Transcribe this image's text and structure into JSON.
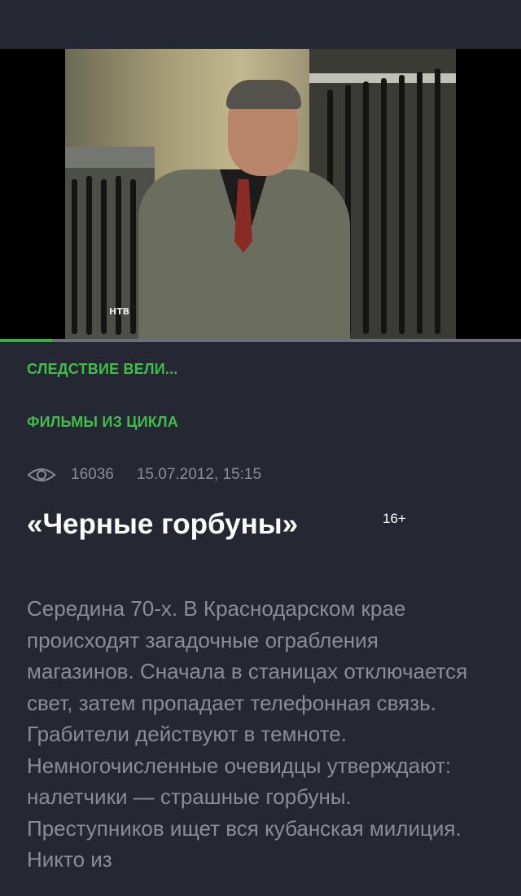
{
  "video": {
    "channel_logo": "НТВ",
    "progress": 0.1
  },
  "show": {
    "name": "СЛЕДСТВИЕ ВЕЛИ...",
    "category": "ФИЛЬМЫ ИЗ ЦИКЛА"
  },
  "meta": {
    "views": "16036",
    "date": "15.07.2012, 15:15"
  },
  "episode": {
    "title": "«Черные горбуны»",
    "age_rating": "16+",
    "description": "Середина 70-х. В Краснодарском крае происходят загадочные ограбления магазинов. Сначала в станицах отключается свет, затем пропадает телефонная связь. Грабители действуют в темноте. Немногочисленные очевидцы утверждают: налетчики — страшные горбуны. Преступников ищет вся кубанская милиция. Никто из"
  },
  "colors": {
    "background": "#252832",
    "accent": "#3fbf49",
    "muted_text": "#8a8d96"
  }
}
